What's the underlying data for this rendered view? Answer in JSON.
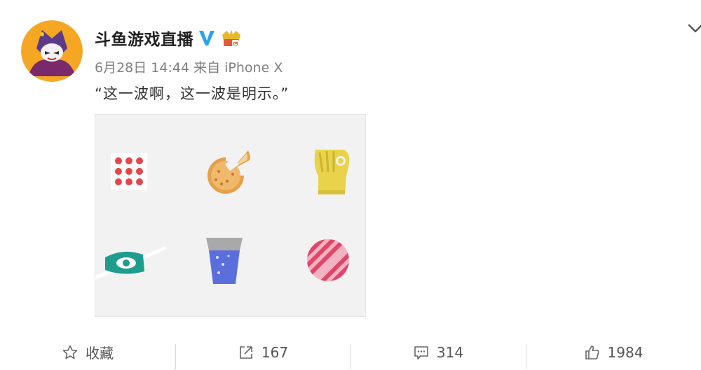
{
  "post": {
    "username": "斗鱼游戏直播",
    "meta": "6月28日 14:44 来自 iPhone X",
    "text": "“这一波啊，这一波是明示。”"
  },
  "icons": {
    "verified": "verified-v-icon",
    "badge": "red-badge-icon",
    "menu": "chevron-down-icon"
  },
  "actions": {
    "favorite_label": "收藏",
    "repost_count": "167",
    "comment_count": "314",
    "like_count": "1984"
  },
  "colors": {
    "verified_blue": "#2ba3f0",
    "image_bg": "#f2f2f2",
    "dots_red": "#e2474a",
    "pie_orange": "#e6a04a",
    "glove_yellow": "#e8d34b",
    "eye_teal": "#1e9c8e",
    "cup_blue": "#5b6fdc",
    "ball_pink": "#e85a7a"
  }
}
